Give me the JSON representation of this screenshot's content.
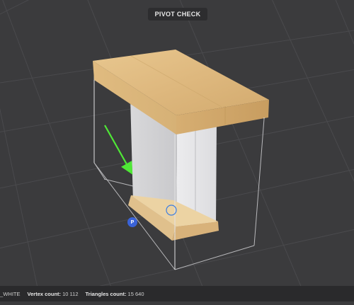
{
  "viewport": {
    "title": "PIVOT CHECK",
    "pivot_marker": "P",
    "arrow_color": "#4fe836",
    "background_color": "#3b3b3d"
  },
  "status_bar": {
    "material": "L_WHITE",
    "vertex_label": "Vertex count:",
    "vertex_value": "10 112",
    "triangles_label": "Triangles count:",
    "triangles_value": "15 640"
  }
}
